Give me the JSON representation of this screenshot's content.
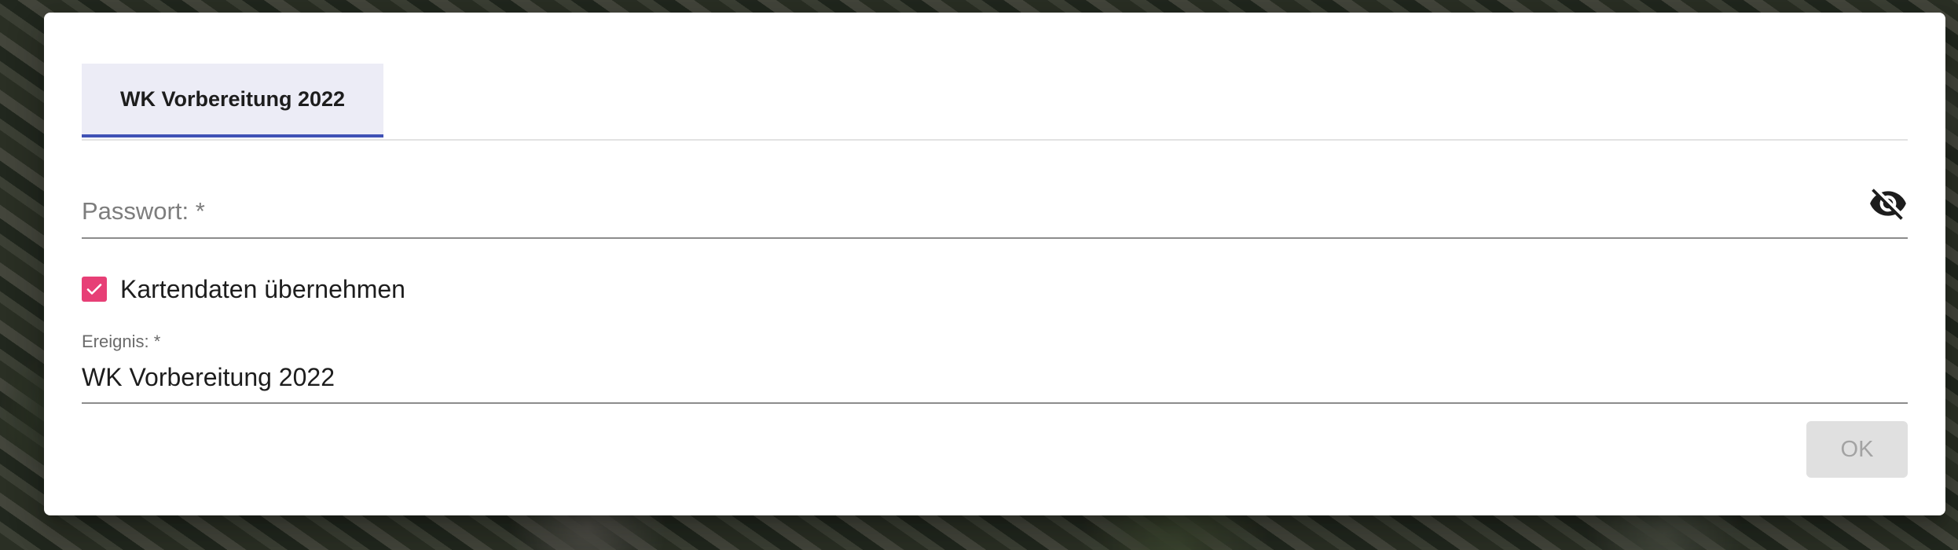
{
  "dialog": {
    "tab": {
      "label": "WK Vorbereitung 2022"
    },
    "password": {
      "placeholder": "Passwort: *",
      "value": "",
      "toggle_icon": "eye-off-icon"
    },
    "map_data_checkbox": {
      "label": "Kartendaten übernehmen",
      "checked": true,
      "color": "#e73f76"
    },
    "event": {
      "label": "Ereignis: *",
      "value": "WK Vorbereitung 2022"
    },
    "ok_button": {
      "label": "OK",
      "disabled": true
    }
  },
  "colors": {
    "accent": "#3f51b5",
    "checkbox": "#e73f76"
  }
}
